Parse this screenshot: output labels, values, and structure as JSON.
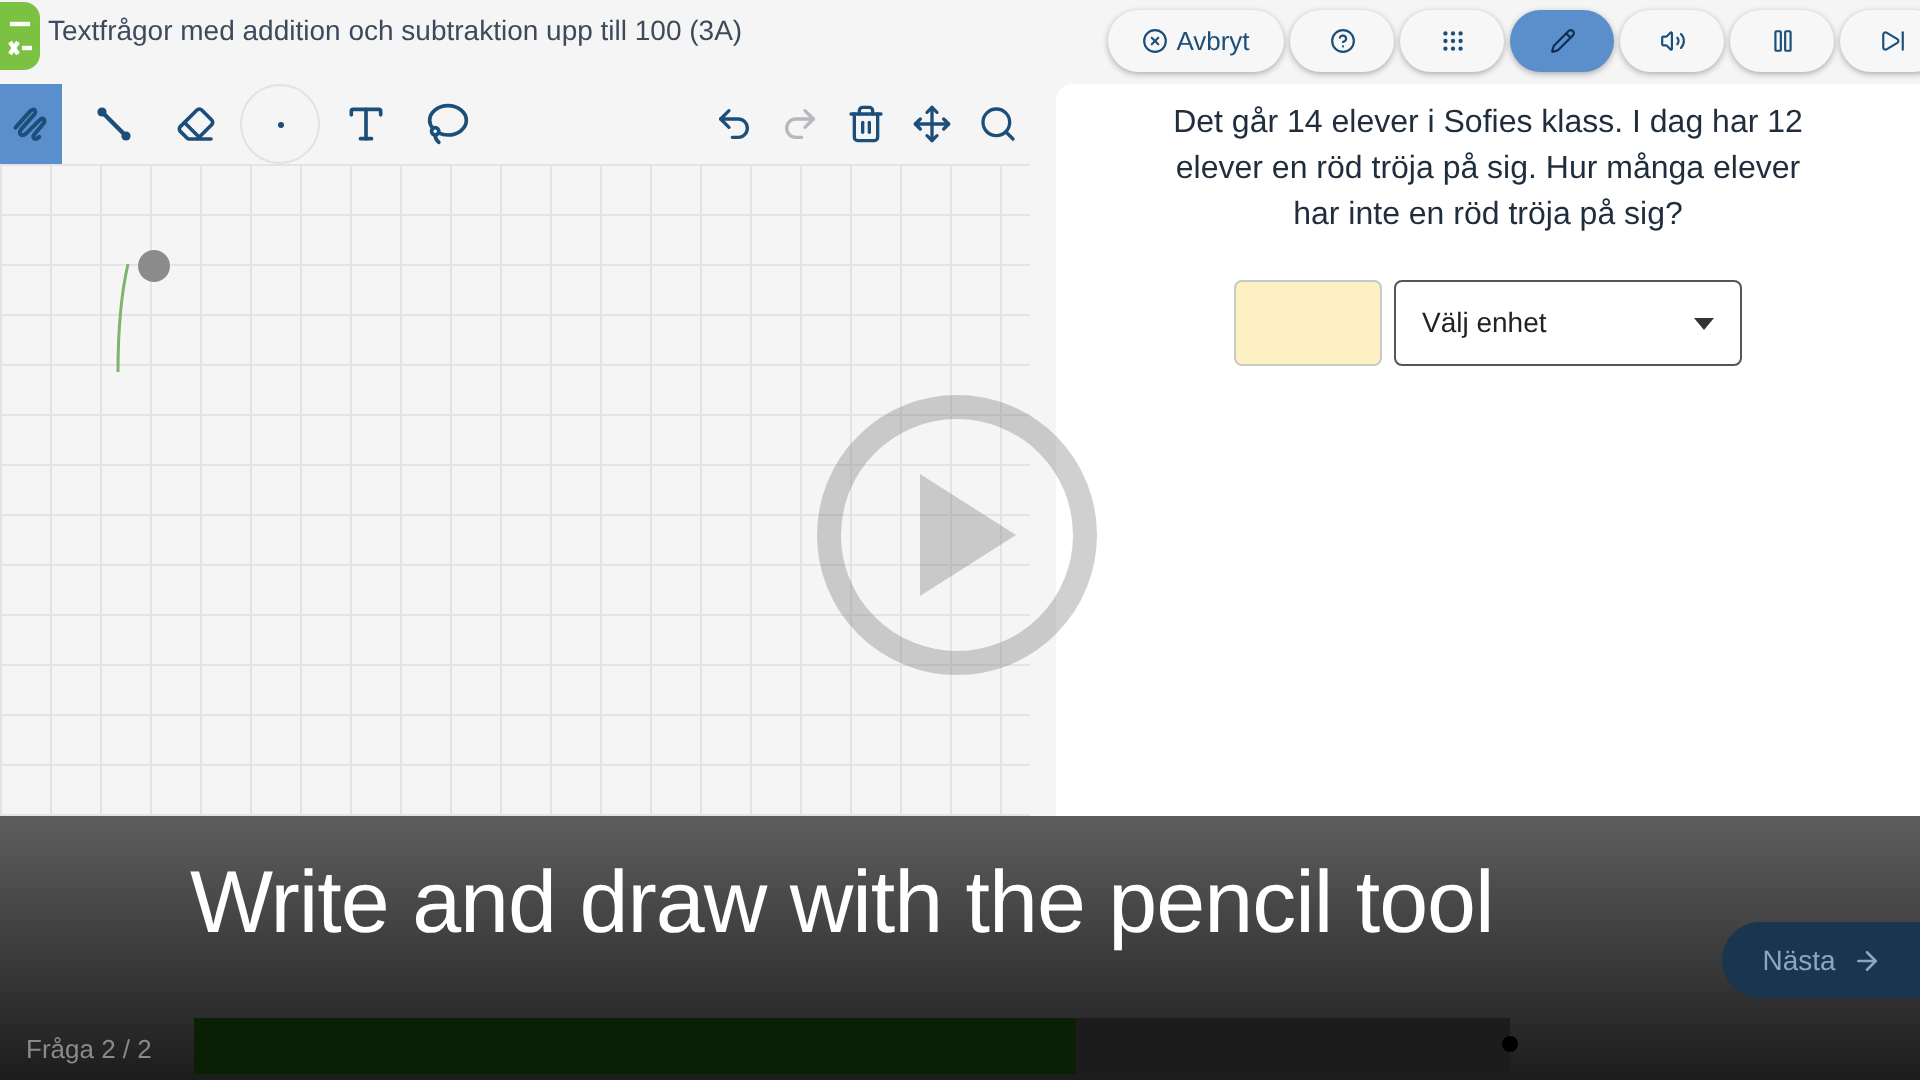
{
  "header": {
    "title": "Textfrågor med addition och subtraktion upp till 100 (3A)",
    "buttons": [
      {
        "kind": "cancel",
        "label": "Avbryt",
        "selected": false
      },
      {
        "kind": "help",
        "selected": false
      },
      {
        "kind": "grid",
        "selected": false
      },
      {
        "kind": "pencil",
        "selected": true
      },
      {
        "kind": "sound",
        "selected": false
      },
      {
        "kind": "pause",
        "selected": false
      },
      {
        "kind": "skip",
        "selected": false
      }
    ]
  },
  "toolbar": {
    "tools": [
      {
        "kind": "pen",
        "selected": true
      },
      {
        "kind": "line",
        "selected": false
      },
      {
        "kind": "eraser",
        "selected": false
      },
      {
        "kind": "size",
        "selected": false
      },
      {
        "kind": "text",
        "selected": false
      },
      {
        "kind": "lasso",
        "selected": false
      }
    ],
    "actions": [
      {
        "kind": "undo",
        "disabled": false
      },
      {
        "kind": "redo",
        "disabled": true
      },
      {
        "kind": "trash",
        "disabled": false
      },
      {
        "kind": "move",
        "disabled": false
      },
      {
        "kind": "zoom",
        "disabled": false
      }
    ]
  },
  "question": {
    "text": "Det går 14 elever i Sofies klass. I dag har 12 elever en röd tröja på sig. Hur många elever har inte en röd tröja på sig?",
    "unit_select": "Välj enhet"
  },
  "caption": "Write and draw with the pencil tool",
  "footer": {
    "progress_label": "Fråga 2 / 2",
    "level": 0.67,
    "next": "Nästa"
  }
}
